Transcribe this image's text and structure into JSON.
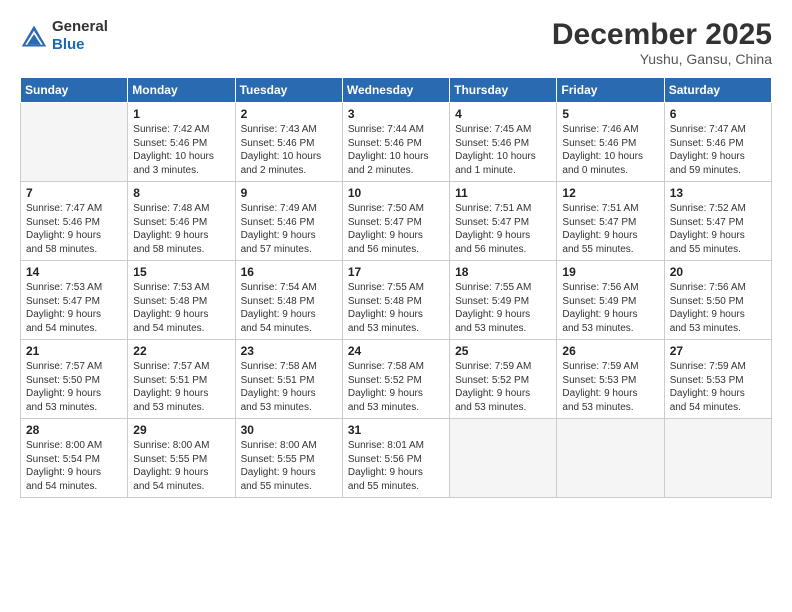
{
  "header": {
    "logo_line1": "General",
    "logo_line2": "Blue",
    "month": "December 2025",
    "location": "Yushu, Gansu, China"
  },
  "weekdays": [
    "Sunday",
    "Monday",
    "Tuesday",
    "Wednesday",
    "Thursday",
    "Friday",
    "Saturday"
  ],
  "weeks": [
    [
      {
        "day": "",
        "info": ""
      },
      {
        "day": "1",
        "info": "Sunrise: 7:42 AM\nSunset: 5:46 PM\nDaylight: 10 hours\nand 3 minutes."
      },
      {
        "day": "2",
        "info": "Sunrise: 7:43 AM\nSunset: 5:46 PM\nDaylight: 10 hours\nand 2 minutes."
      },
      {
        "day": "3",
        "info": "Sunrise: 7:44 AM\nSunset: 5:46 PM\nDaylight: 10 hours\nand 2 minutes."
      },
      {
        "day": "4",
        "info": "Sunrise: 7:45 AM\nSunset: 5:46 PM\nDaylight: 10 hours\nand 1 minute."
      },
      {
        "day": "5",
        "info": "Sunrise: 7:46 AM\nSunset: 5:46 PM\nDaylight: 10 hours\nand 0 minutes."
      },
      {
        "day": "6",
        "info": "Sunrise: 7:47 AM\nSunset: 5:46 PM\nDaylight: 9 hours\nand 59 minutes."
      }
    ],
    [
      {
        "day": "7",
        "info": "Sunrise: 7:47 AM\nSunset: 5:46 PM\nDaylight: 9 hours\nand 58 minutes."
      },
      {
        "day": "8",
        "info": "Sunrise: 7:48 AM\nSunset: 5:46 PM\nDaylight: 9 hours\nand 58 minutes."
      },
      {
        "day": "9",
        "info": "Sunrise: 7:49 AM\nSunset: 5:46 PM\nDaylight: 9 hours\nand 57 minutes."
      },
      {
        "day": "10",
        "info": "Sunrise: 7:50 AM\nSunset: 5:47 PM\nDaylight: 9 hours\nand 56 minutes."
      },
      {
        "day": "11",
        "info": "Sunrise: 7:51 AM\nSunset: 5:47 PM\nDaylight: 9 hours\nand 56 minutes."
      },
      {
        "day": "12",
        "info": "Sunrise: 7:51 AM\nSunset: 5:47 PM\nDaylight: 9 hours\nand 55 minutes."
      },
      {
        "day": "13",
        "info": "Sunrise: 7:52 AM\nSunset: 5:47 PM\nDaylight: 9 hours\nand 55 minutes."
      }
    ],
    [
      {
        "day": "14",
        "info": "Sunrise: 7:53 AM\nSunset: 5:47 PM\nDaylight: 9 hours\nand 54 minutes."
      },
      {
        "day": "15",
        "info": "Sunrise: 7:53 AM\nSunset: 5:48 PM\nDaylight: 9 hours\nand 54 minutes."
      },
      {
        "day": "16",
        "info": "Sunrise: 7:54 AM\nSunset: 5:48 PM\nDaylight: 9 hours\nand 54 minutes."
      },
      {
        "day": "17",
        "info": "Sunrise: 7:55 AM\nSunset: 5:48 PM\nDaylight: 9 hours\nand 53 minutes."
      },
      {
        "day": "18",
        "info": "Sunrise: 7:55 AM\nSunset: 5:49 PM\nDaylight: 9 hours\nand 53 minutes."
      },
      {
        "day": "19",
        "info": "Sunrise: 7:56 AM\nSunset: 5:49 PM\nDaylight: 9 hours\nand 53 minutes."
      },
      {
        "day": "20",
        "info": "Sunrise: 7:56 AM\nSunset: 5:50 PM\nDaylight: 9 hours\nand 53 minutes."
      }
    ],
    [
      {
        "day": "21",
        "info": "Sunrise: 7:57 AM\nSunset: 5:50 PM\nDaylight: 9 hours\nand 53 minutes."
      },
      {
        "day": "22",
        "info": "Sunrise: 7:57 AM\nSunset: 5:51 PM\nDaylight: 9 hours\nand 53 minutes."
      },
      {
        "day": "23",
        "info": "Sunrise: 7:58 AM\nSunset: 5:51 PM\nDaylight: 9 hours\nand 53 minutes."
      },
      {
        "day": "24",
        "info": "Sunrise: 7:58 AM\nSunset: 5:52 PM\nDaylight: 9 hours\nand 53 minutes."
      },
      {
        "day": "25",
        "info": "Sunrise: 7:59 AM\nSunset: 5:52 PM\nDaylight: 9 hours\nand 53 minutes."
      },
      {
        "day": "26",
        "info": "Sunrise: 7:59 AM\nSunset: 5:53 PM\nDaylight: 9 hours\nand 53 minutes."
      },
      {
        "day": "27",
        "info": "Sunrise: 7:59 AM\nSunset: 5:53 PM\nDaylight: 9 hours\nand 54 minutes."
      }
    ],
    [
      {
        "day": "28",
        "info": "Sunrise: 8:00 AM\nSunset: 5:54 PM\nDaylight: 9 hours\nand 54 minutes."
      },
      {
        "day": "29",
        "info": "Sunrise: 8:00 AM\nSunset: 5:55 PM\nDaylight: 9 hours\nand 54 minutes."
      },
      {
        "day": "30",
        "info": "Sunrise: 8:00 AM\nSunset: 5:55 PM\nDaylight: 9 hours\nand 55 minutes."
      },
      {
        "day": "31",
        "info": "Sunrise: 8:01 AM\nSunset: 5:56 PM\nDaylight: 9 hours\nand 55 minutes."
      },
      {
        "day": "",
        "info": ""
      },
      {
        "day": "",
        "info": ""
      },
      {
        "day": "",
        "info": ""
      }
    ]
  ]
}
